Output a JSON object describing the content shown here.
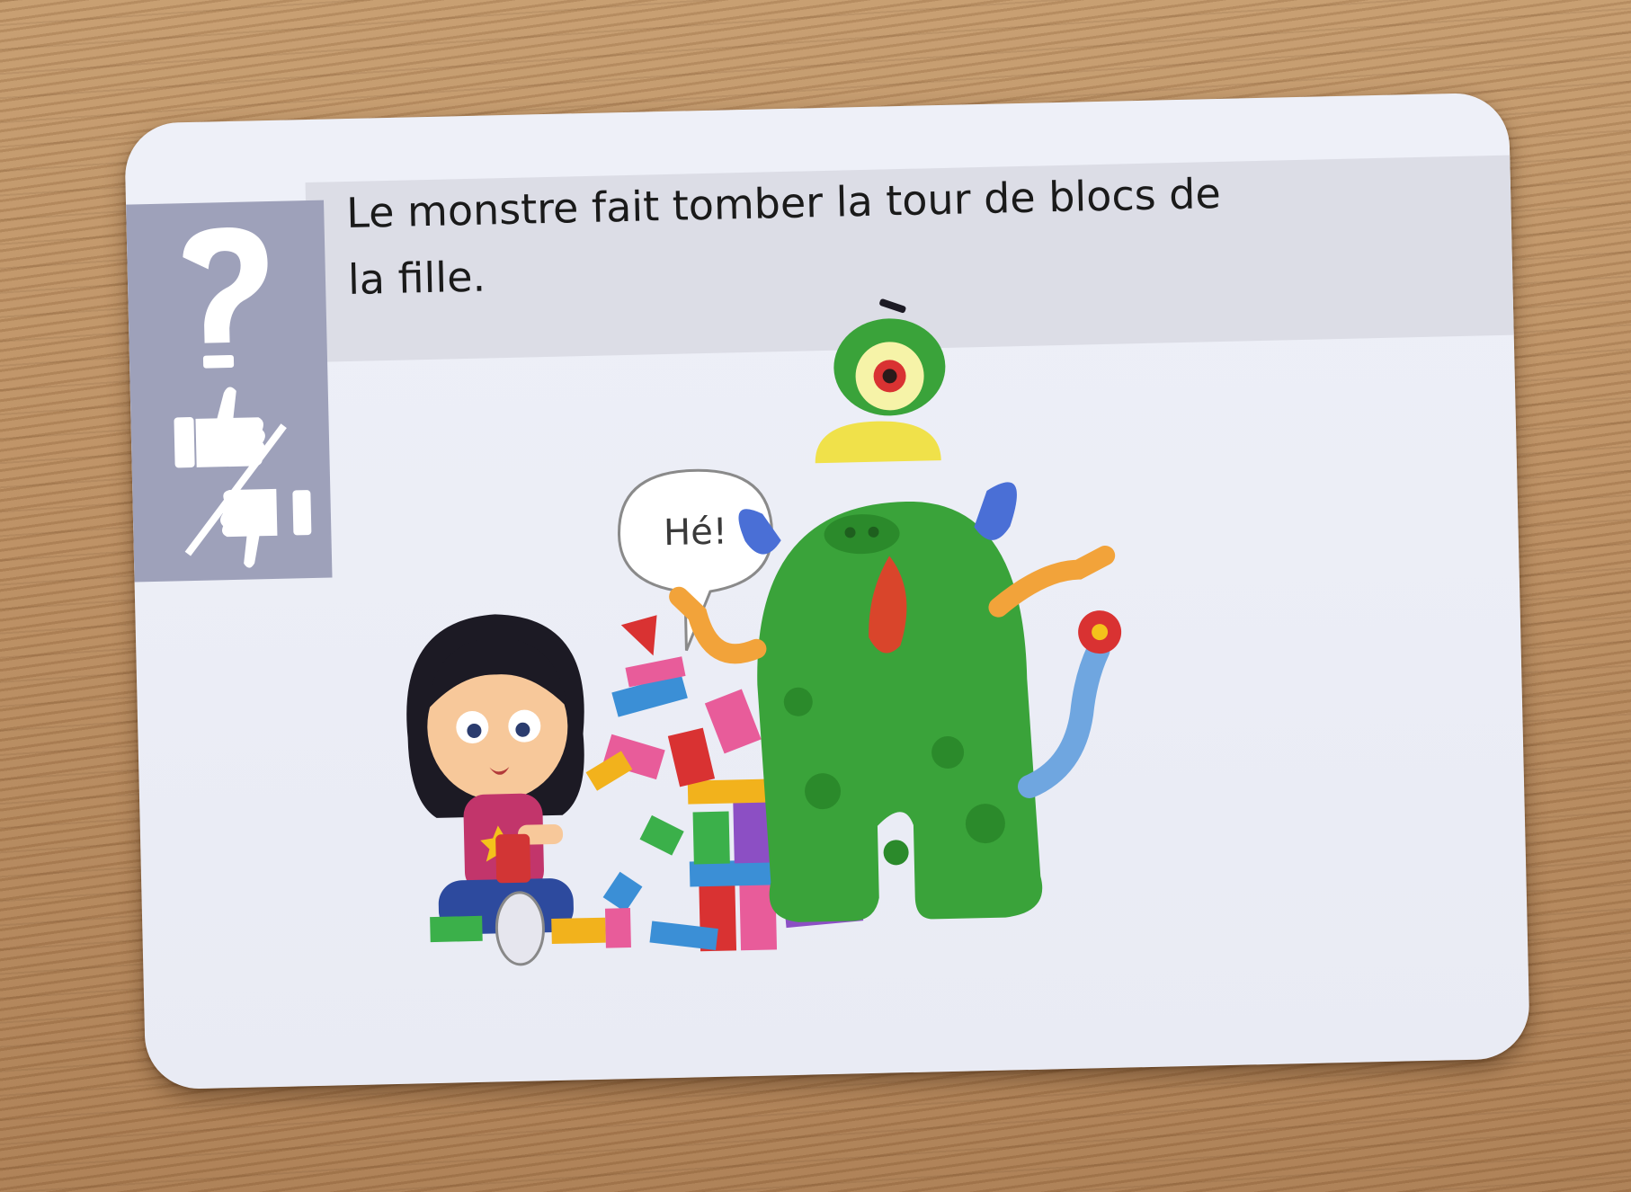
{
  "card": {
    "question": "Le monstre fait tomber la tour de blocs de la fille.",
    "speech": "Hé!"
  },
  "icons": [
    "question-mark-icon",
    "thumbs-up-icon",
    "slash-divider",
    "thumbs-down-icon"
  ],
  "colors": {
    "card_background": "#eef0f8",
    "header_band": "#dcdde6",
    "side_tab": "#9ea1ba",
    "monster_green": "#3aa33a",
    "table_wood": "#b98c5f"
  }
}
